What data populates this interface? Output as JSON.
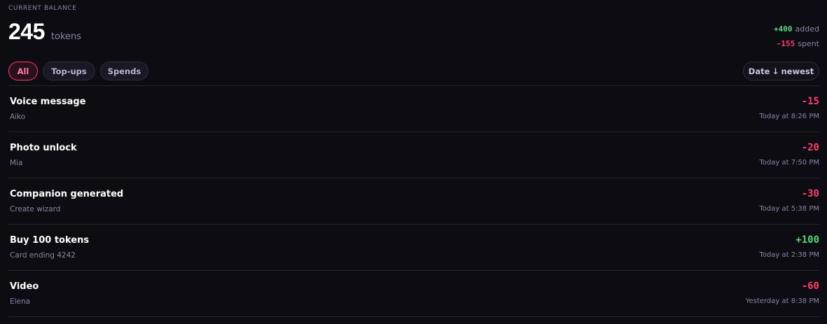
{
  "balance": {
    "caption": "CURRENT BALANCE",
    "amount": "245",
    "unit": "tokens"
  },
  "summary": {
    "added_value": "+400",
    "added_label": "added",
    "spent_value": "-155",
    "spent_label": "spent"
  },
  "filters": {
    "all": "All",
    "topups": "Top-ups",
    "spends": "Spends",
    "active": "All"
  },
  "sort": {
    "label": "Date",
    "arrow": "↓",
    "order": "newest"
  },
  "transactions": [
    {
      "title": "Voice message",
      "subtitle": "Aiko",
      "amount": "-15",
      "time": "Today at 8:26 PM",
      "kind": "spend"
    },
    {
      "title": "Photo unlock",
      "subtitle": "Mia",
      "amount": "-20",
      "time": "Today at 7:50 PM",
      "kind": "spend"
    },
    {
      "title": "Companion generated",
      "subtitle": "Create wizard",
      "amount": "-30",
      "time": "Today at 5:38 PM",
      "kind": "spend"
    },
    {
      "title": "Buy 100 tokens",
      "subtitle": "Card ending 4242",
      "amount": "+100",
      "time": "Today at 2:38 PM",
      "kind": "topup"
    },
    {
      "title": "Video",
      "subtitle": "Elena",
      "amount": "-60",
      "time": "Yesterday at 8:38 PM",
      "kind": "spend"
    }
  ],
  "colors": {
    "background": "#0d0c12",
    "positive": "#4fd97a",
    "negative": "#ff3d6e",
    "muted": "#8b84a6",
    "accent": "#ff3d6e"
  }
}
